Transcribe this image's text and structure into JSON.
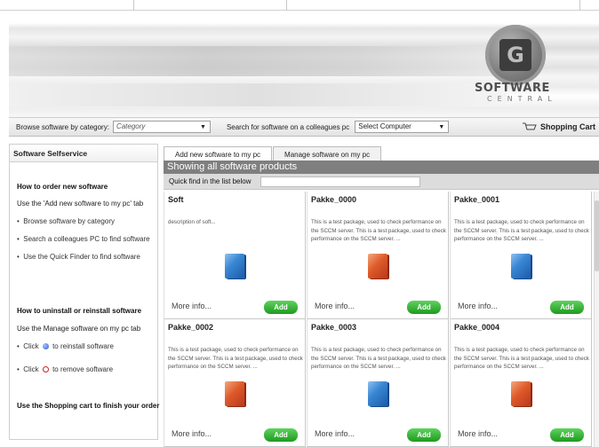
{
  "header": {
    "logo_letter": "G",
    "logo_title": "SOFTWARE",
    "logo_subtitle": "CENTRAL"
  },
  "toolbar": {
    "browse_label": "Browse software by category:",
    "category_value": "Category",
    "search_label": "Search for software on a colleagues pc",
    "computer_value": "Select Computer",
    "cart_label": "Shopping Cart"
  },
  "sidebar": {
    "title": "Software Selfservice",
    "order_heading": "How to order new software",
    "order_text": "Use the 'Add new software to my pc' tab",
    "order_bullets": [
      "Browse software by category",
      "Search a colleagues PC to find software",
      "Use the Quick Finder to find software"
    ],
    "uninstall_heading": "How to uninstall or reinstall software",
    "uninstall_text": "Use the Manage software on my pc tab",
    "reinstall_text": "to reinstall software",
    "remove_text": "to remove software",
    "cart_text": "Use the Shopping cart to finish your order",
    "click_word": "Click",
    "bullet": "•"
  },
  "main": {
    "tabs": [
      "Add new software to my pc",
      "Manage software on my pc"
    ],
    "showing": "Showing all software products",
    "quickfind_label": "Quick find in the list below",
    "quickfind_value": "",
    "more_label": "More info...",
    "add_label": "Add",
    "products": [
      {
        "name": "Soft",
        "description": "description of soft...",
        "box_color": "blue"
      },
      {
        "name": "Pakke_0000",
        "description": "This is a test package, used to check performance on the SCCM server. This is a test package, used to check performance on the SCCM server. ...",
        "box_color": "orange"
      },
      {
        "name": "Pakke_0001",
        "description": "This is a test package, used to check performance on the SCCM server. This is a test package, used to check performance on the SCCM server. ...",
        "box_color": "blue"
      },
      {
        "name": "Pakke_0002",
        "description": "This is a test package, used to check performance on the SCCM server. This is a test package, used to check performance on the SCCM server. ...",
        "box_color": "orange"
      },
      {
        "name": "Pakke_0003",
        "description": "This is a test package, used to check performance on the SCCM server. This is a test package, used to check performance on the SCCM server. ...",
        "box_color": "blue"
      },
      {
        "name": "Pakke_0004",
        "description": "This is a test package, used to check performance on the SCCM server. This is a test package, used to check performance on the SCCM server. ...",
        "box_color": "orange"
      }
    ]
  }
}
